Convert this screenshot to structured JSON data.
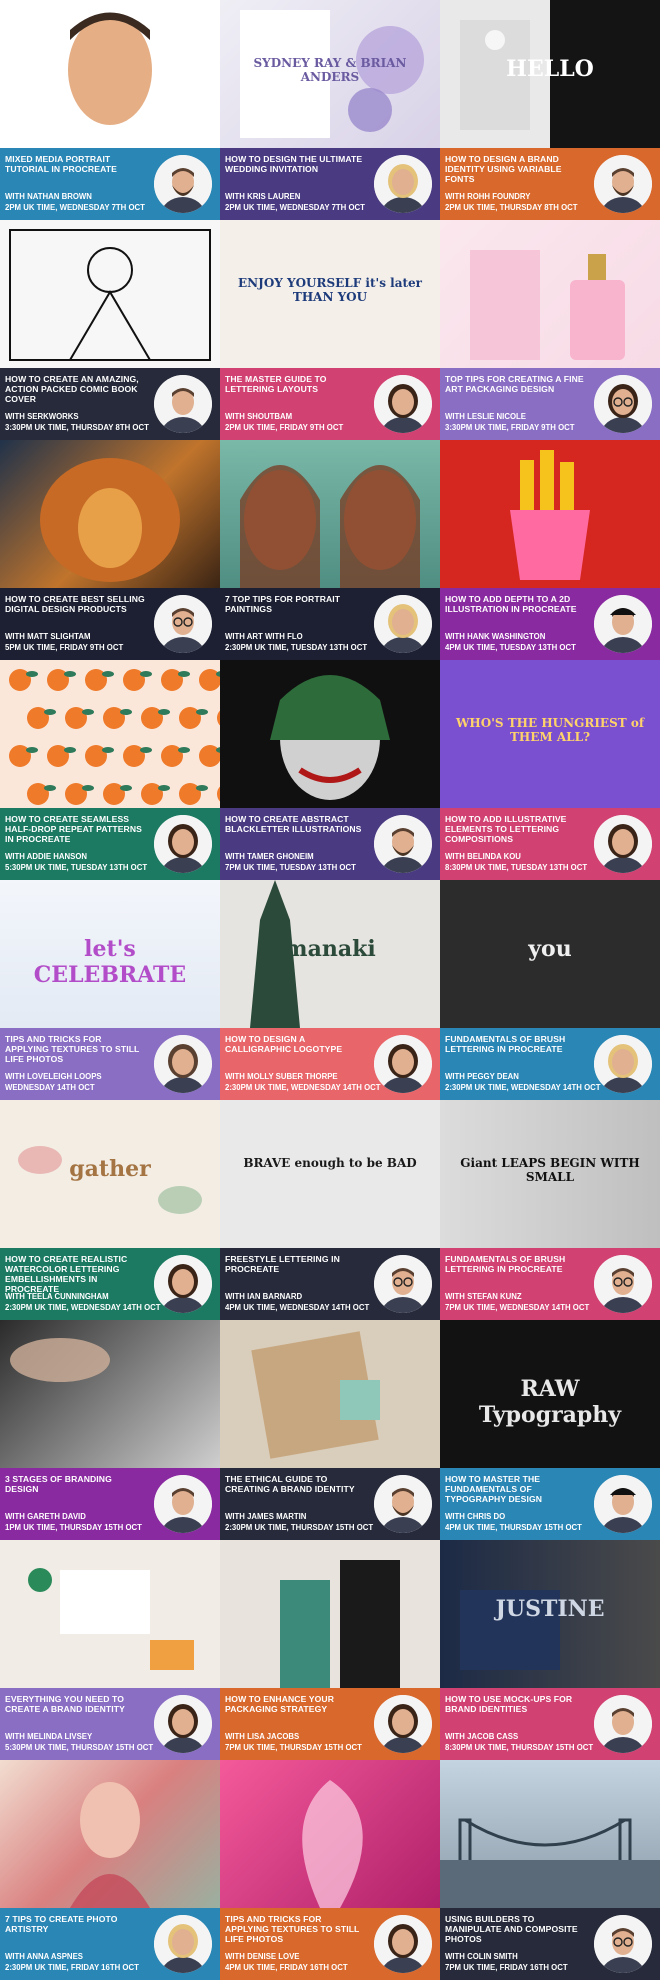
{
  "cards": [
    {
      "title": "MIXED MEDIA PORTRAIT TUTORIAL IN PROCREATE",
      "host": "WITH NATHAN BROWN",
      "time": "2PM UK TIME, WEDNESDAY 7TH OCT",
      "color": "#2a86b5",
      "art": "portrait-illustration",
      "art_text": "",
      "avatar": "man-beard"
    },
    {
      "title": "HOW TO DESIGN THE ULTIMATE WEDDING INVITATION",
      "host": "WITH KRIS LAUREN",
      "time": "2PM UK TIME, WEDNESDAY 7TH OCT",
      "color": "#4a3a82",
      "art": "floral-invitation",
      "art_text": "SYDNEY RAY & BRIAN ANDERS",
      "avatar": "woman-blonde"
    },
    {
      "title": "HOW TO DESIGN A BRAND IDENTITY USING VARIABLE FONTS",
      "host": "WITH ROHH FOUNDRY",
      "time": "2PM UK TIME, THURSDAY 8TH OCT",
      "color": "#d8682c",
      "art": "hello-brand",
      "art_text": "HELLO",
      "avatar": "man-beard"
    },
    {
      "title": "HOW TO CREATE AN AMAZING, ACTION PACKED COMIC BOOK COVER",
      "host": "WITH SERKWORKS",
      "time": "3:30PM UK TIME, THURSDAY 8TH OCT",
      "color": "#262a3a",
      "art": "comic-lineart",
      "art_text": "",
      "avatar": "man-smile"
    },
    {
      "title": "THE MASTER GUIDE TO LETTERING LAYOUTS",
      "host": "WITH SHOUTBAM",
      "time": "2PM UK TIME, FRIDAY 9TH OCT",
      "color": "#d14172",
      "art": "enjoy-lettering",
      "art_text": "ENJOY YOURSELF it's later THAN YOU",
      "avatar": "woman-dark"
    },
    {
      "title": "TOP TIPS FOR CREATING A FINE ART PACKAGING DESIGN",
      "host": "WITH LESLIE NICOLE",
      "time": "3:30PM UK TIME, FRIDAY 9TH OCT",
      "color": "#8a6ec4",
      "art": "perfume-packaging",
      "art_text": "",
      "avatar": "woman-glasses"
    },
    {
      "title": "HOW TO CREATE BEST SELLING DIGITAL DESIGN PRODUCTS",
      "host": "WITH MATT SLIGHTAM",
      "time": "5PM UK TIME, FRIDAY 9TH OCT",
      "color": "#1c2032",
      "art": "lion-painting",
      "art_text": "",
      "avatar": "man-glasses"
    },
    {
      "title": "7 TOP TIPS FOR PORTRAIT PAINTINGS",
      "host": "WITH ART WITH FLO",
      "time": "2:30PM UK TIME, TUESDAY 13TH OCT",
      "color": "#1c2032",
      "art": "portrait-faces",
      "art_text": "",
      "avatar": "woman-blonde"
    },
    {
      "title": "HOW TO ADD DEPTH TO A 2D ILLUSTRATION IN PROCREATE",
      "host": "WITH HANK WASHINGTON",
      "time": "4PM UK TIME, TUESDAY 13TH OCT",
      "color": "#8a2aa0",
      "art": "fries-illustration",
      "art_text": "",
      "avatar": "man-cap"
    },
    {
      "title": "HOW TO CREATE SEAMLESS HALF-DROP REPEAT PATTERNS IN PROCREATE",
      "host": "WITH ADDIE HANSON",
      "time": "5:30PM UK TIME, TUESDAY 13TH OCT",
      "color": "#1c7a63",
      "art": "orange-pattern",
      "art_text": "",
      "avatar": "woman-dark"
    },
    {
      "title": "HOW TO CREATE ABSTRACT BLACKLETTER ILLUSTRATIONS",
      "host": "WITH TAMER GHONEIM",
      "time": "7PM UK TIME, TUESDAY 13TH OCT",
      "color": "#4a3a82",
      "art": "joker-blackletter",
      "art_text": "",
      "avatar": "man-beard"
    },
    {
      "title": "HOW TO ADD ILLUSTRATIVE ELEMENTS TO LETTERING COMPOSITIONS",
      "host": "WITH BELINDA KOU",
      "time": "8:30PM UK TIME, TUESDAY 13TH OCT",
      "color": "#d14172",
      "art": "hungriest-lettering",
      "art_text": "WHO'S THE HUNGRIEST of THEM ALL?",
      "avatar": "woman-dark"
    },
    {
      "title": "TIPS AND TRICKS FOR APPLYING TEXTURES TO STILL LIFE PHOTOS",
      "host": "WITH LOVELEIGH LOOPS",
      "time": "WEDNESDAY 14TH OCT",
      "color": "#8a6ec4",
      "art": "celebrate-type",
      "art_text": "let's CELEBRATE",
      "avatar": "two-women"
    },
    {
      "title": "HOW TO DESIGN A CALLIGRAPHIC LOGOTYPE",
      "host": "WITH MOLLY SUBER THORPE",
      "time": "2:30PM UK TIME, WEDNESDAY 14TH OCT",
      "color": "#e8666a",
      "art": "manaki-bottle",
      "art_text": "manaki",
      "avatar": "woman-dark"
    },
    {
      "title": "FUNDAMENTALS OF BRUSH LETTERING IN PROCREATE",
      "host": "WITH PEGGY DEAN",
      "time": "2:30PM UK TIME, WEDNESDAY 14TH OCT",
      "color": "#2a86b5",
      "art": "you-lettering",
      "art_text": "you",
      "avatar": "woman-blonde"
    },
    {
      "title": "HOW TO CREATE REALISTIC WATERCOLOR LETTERING EMBELLISHMENTS IN PROCREATE",
      "host": "WITH TEELA CUNNINGHAM",
      "time": "2:30PM UK TIME, WEDNESDAY 14TH OCT",
      "color": "#1c7a63",
      "art": "gather-watercolor",
      "art_text": "gather",
      "avatar": "woman-dark"
    },
    {
      "title": "FREESTYLE LETTERING IN PROCREATE",
      "host": "WITH IAN BARNARD",
      "time": "4PM UK TIME, WEDNESDAY 14TH OCT",
      "color": "#262a3a",
      "art": "brave-lettering",
      "art_text": "BRAVE enough to be BAD",
      "avatar": "man-glasses"
    },
    {
      "title": "FUNDAMENTALS OF BRUSH LETTERING IN PROCREATE",
      "host": "WITH STEFAN KUNZ",
      "time": "7PM UK TIME, WEDNESDAY 14TH OCT",
      "color": "#d14172",
      "art": "giant-leaps",
      "art_text": "Giant LEAPS BEGIN WITH SMALL",
      "avatar": "man-glasses"
    },
    {
      "title": "3 STAGES OF BRANDING DESIGN",
      "host": "WITH GARETH DAVID",
      "time": "1PM UK TIME, THURSDAY 15TH OCT",
      "color": "#8a2aa0",
      "art": "sketching-hand",
      "art_text": "",
      "avatar": "man-smile"
    },
    {
      "title": "THE ETHICAL GUIDE TO CREATING A BRAND IDENTITY",
      "host": "WITH JAMES MARTIN",
      "time": "2:30PM UK TIME, THURSDAY 15TH OCT",
      "color": "#262a3a",
      "art": "kraft-packaging",
      "art_text": "",
      "avatar": "man-beard"
    },
    {
      "title": "HOW TO MASTER THE FUNDAMENTALS OF TYPOGRAPHY DESIGN",
      "host": "WITH CHRIS DO",
      "time": "4PM UK TIME, THURSDAY 15TH OCT",
      "color": "#2a86b5",
      "art": "raw-typography",
      "art_text": "RAW Typography",
      "avatar": "man-cap"
    },
    {
      "title": "EVERYTHING YOU NEED TO CREATE A BRAND IDENTITY",
      "host": "WITH MELINDA LIVSEY",
      "time": "5:30PM UK TIME, THURSDAY 15TH OCT",
      "color": "#8a6ec4",
      "art": "stationery-flatlay",
      "art_text": "",
      "avatar": "woman-dark"
    },
    {
      "title": "HOW TO ENHANCE YOUR PACKAGING STRATEGY",
      "host": "WITH LISA JACOBS",
      "time": "7PM UK TIME, THURSDAY 15TH OCT",
      "color": "#d8682c",
      "art": "teal-packaging",
      "art_text": "",
      "avatar": "woman-dark"
    },
    {
      "title": "HOW TO USE MOCK-UPS FOR BRAND IDENTITIES",
      "host": "WITH JACOB CASS",
      "time": "8:30PM UK TIME, THURSDAY 15TH OCT",
      "color": "#d14172",
      "art": "justine-mockup",
      "art_text": "JUSTINE",
      "avatar": "man-smile"
    },
    {
      "title": "7 TIPS TO CREATE PHOTO ARTISTRY",
      "host": "WITH ANNA ASPNES",
      "time": "2:30PM UK TIME, FRIDAY 16TH OCT",
      "color": "#2a86b5",
      "art": "photo-artistry",
      "art_text": "",
      "avatar": "woman-blonde"
    },
    {
      "title": "TIPS AND TRICKS FOR APPLYING TEXTURES TO STILL LIFE PHOTOS",
      "host": "WITH DENISE LOVE",
      "time": "4PM UK TIME, FRIDAY 16TH OCT",
      "color": "#d8682c",
      "art": "calla-lily",
      "art_text": "",
      "avatar": "woman-dark"
    },
    {
      "title": "USING BUILDERS TO MANIPULATE AND COMPOSITE PHOTOS",
      "host": "WITH COLIN SMITH",
      "time": "7PM UK TIME, FRIDAY 16TH OCT",
      "color": "#262a3a",
      "art": "bridge-composite",
      "art_text": "",
      "avatar": "man-glasses"
    }
  ]
}
